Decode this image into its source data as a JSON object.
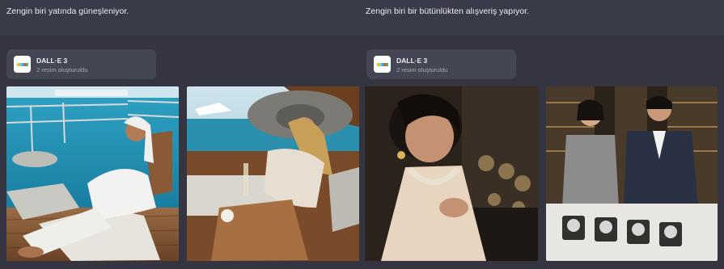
{
  "left": {
    "prompt": "Zengin biri yatında güneşleniyor.",
    "badge": {
      "title": "DALL·E 3",
      "subtitle": "2 resim oluşturuldu"
    },
    "images": [
      {
        "label": "generated-image-yacht-man"
      },
      {
        "label": "generated-image-yacht-woman"
      }
    ]
  },
  "right": {
    "prompt": "Zengin biri bir bütünlükten alışveriş yapıyor.",
    "badge": {
      "title": "DALL·E 3",
      "subtitle": "2 resim oluşturuldu"
    },
    "images": [
      {
        "label": "generated-image-jewelry-woman"
      },
      {
        "label": "generated-image-watch-shop"
      }
    ]
  },
  "colors": {
    "background": "#343541",
    "badge": "#444654",
    "text": "#ececf1",
    "muted": "#a9aab6"
  }
}
